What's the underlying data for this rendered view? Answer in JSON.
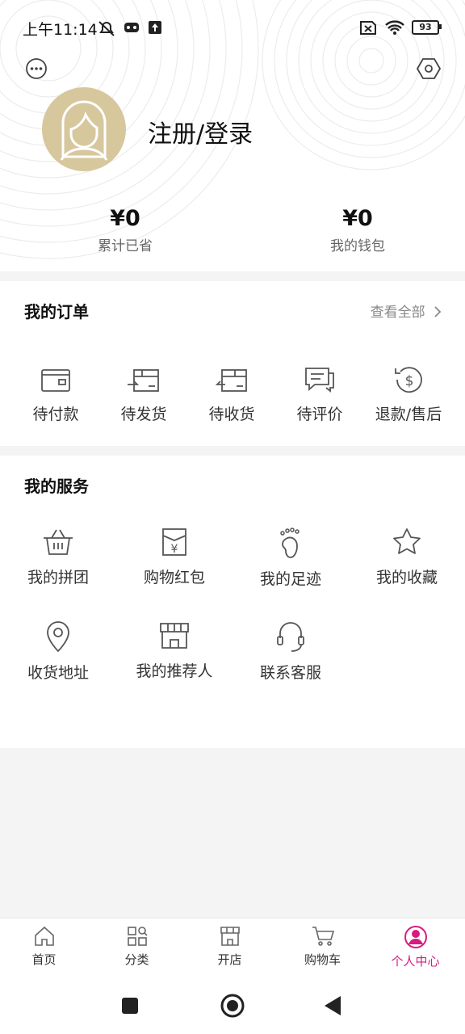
{
  "status_bar": {
    "time": "上午11:14",
    "battery": "93"
  },
  "profile": {
    "login_label": "注册/登录"
  },
  "stats": [
    {
      "value": "¥0",
      "label": "累计已省"
    },
    {
      "value": "¥0",
      "label": "我的钱包"
    }
  ],
  "orders": {
    "title": "我的订单",
    "view_all": "查看全部",
    "items": [
      {
        "label": "待付款",
        "icon": "wallet-icon"
      },
      {
        "label": "待发货",
        "icon": "ship-box-icon"
      },
      {
        "label": "待收货",
        "icon": "receive-box-icon"
      },
      {
        "label": "待评价",
        "icon": "comment-icon"
      },
      {
        "label": "退款/售后",
        "icon": "refund-icon"
      }
    ]
  },
  "services": {
    "title": "我的服务",
    "items": [
      {
        "label": "我的拼团",
        "icon": "basket-icon"
      },
      {
        "label": "购物红包",
        "icon": "red-envelope-icon"
      },
      {
        "label": "我的足迹",
        "icon": "footprint-icon"
      },
      {
        "label": "我的收藏",
        "icon": "star-icon"
      },
      {
        "label": "收货地址",
        "icon": "location-icon"
      },
      {
        "label": "我的推荐人",
        "icon": "store-icon"
      },
      {
        "label": "联系客服",
        "icon": "headset-icon"
      }
    ]
  },
  "tabbar": {
    "items": [
      {
        "label": "首页",
        "icon": "home-icon"
      },
      {
        "label": "分类",
        "icon": "category-icon"
      },
      {
        "label": "开店",
        "icon": "shop-icon"
      },
      {
        "label": "购物车",
        "icon": "cart-icon"
      },
      {
        "label": "个人中心",
        "icon": "user-icon"
      }
    ],
    "active_index": 4,
    "active_color": "#d81b7f"
  }
}
